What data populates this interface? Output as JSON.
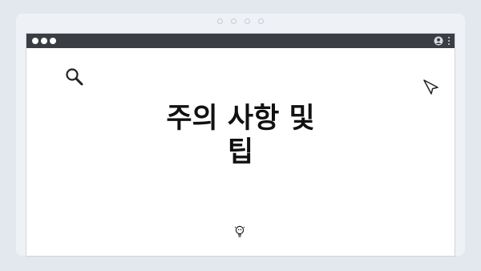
{
  "headline": {
    "line1": "주의 사항 및",
    "line2": "팁"
  },
  "icons": {
    "search": "search-icon",
    "cursor": "cursor-arrow-icon",
    "bulb": "lightbulb-icon",
    "account": "account-icon",
    "menu": "kebab-menu-icon"
  },
  "colors": {
    "background": "#e3e8ee",
    "titlebar": "#3a3d42",
    "text": "#111111"
  }
}
